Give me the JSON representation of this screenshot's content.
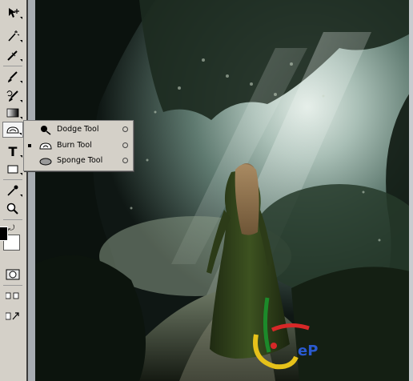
{
  "toolbox": {
    "tools": [
      {
        "name": "move-tool",
        "icon": "move-icon"
      },
      {
        "name": "magic-wand-tool",
        "icon": "magic-wand-icon"
      },
      {
        "name": "healing-brush-tool",
        "icon": "healing-brush-icon"
      },
      {
        "name": "brush-tool",
        "icon": "brush-icon"
      },
      {
        "name": "history-brush-tool",
        "icon": "history-brush-icon"
      },
      {
        "name": "gradient-tool",
        "icon": "gradient-icon"
      },
      {
        "name": "dodge-tool",
        "icon": "dodge-icon",
        "active": true
      },
      {
        "name": "type-tool",
        "icon": "type-icon"
      },
      {
        "name": "shape-tool",
        "icon": "rectangle-icon"
      },
      {
        "name": "eyedropper-tool",
        "icon": "eyedropper-icon"
      },
      {
        "name": "zoom-tool",
        "icon": "zoom-icon"
      }
    ],
    "type_glyph": "T"
  },
  "flyout": {
    "items": [
      {
        "label": "Dodge Tool",
        "icon": "dodge-icon",
        "selected": false
      },
      {
        "label": "Burn Tool",
        "icon": "burn-icon",
        "selected": true
      },
      {
        "label": "Sponge Tool",
        "icon": "sponge-icon",
        "selected": false
      }
    ]
  },
  "colors": {
    "foreground": "#000000",
    "background": "#ffffff",
    "panel": "#d4d0c8"
  },
  "watermark": {
    "text": "eP"
  }
}
